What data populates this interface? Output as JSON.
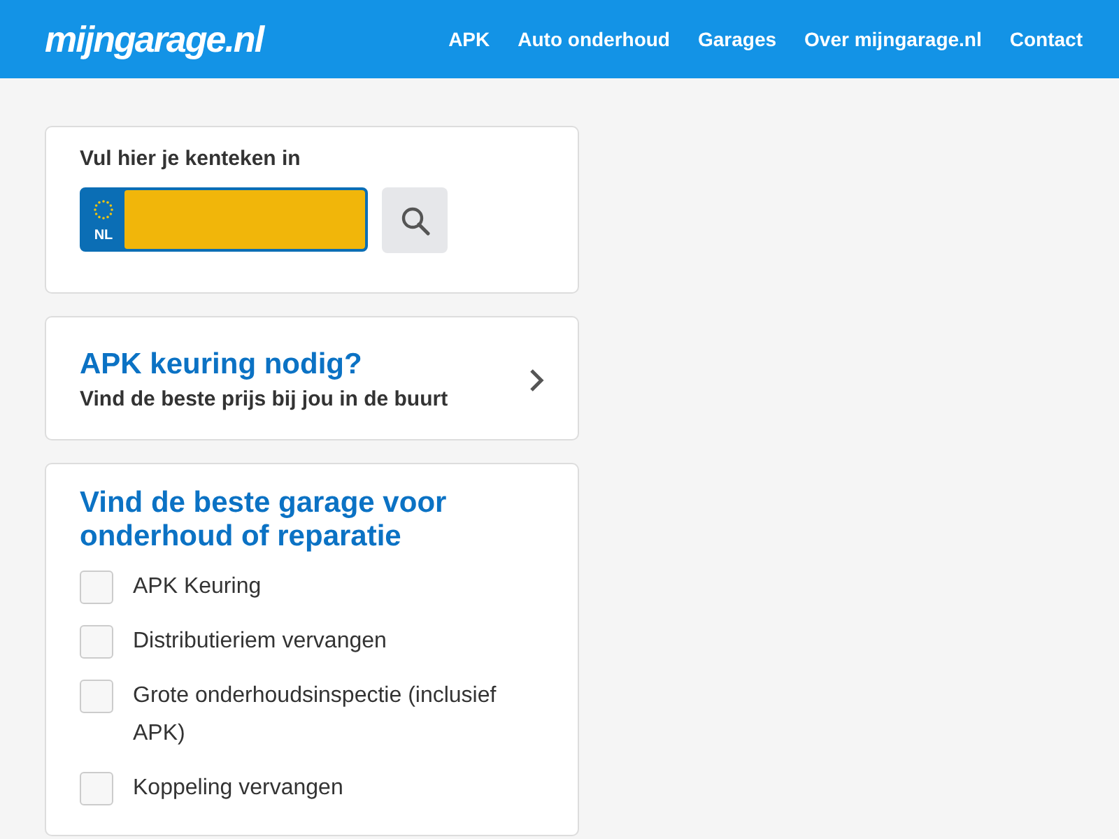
{
  "header": {
    "logo": "mijngarage.nl",
    "nav": [
      "APK",
      "Auto onderhoud",
      "Garages",
      "Over mijngarage.nl",
      "Contact"
    ]
  },
  "plate_card": {
    "label": "Vul hier je kenteken in",
    "country": "NL"
  },
  "apk_card": {
    "title": "APK keuring nodig?",
    "subtitle": "Vind de beste prijs bij jou in de buurt"
  },
  "services_card": {
    "title": "Vind de beste garage voor onderhoud of reparatie",
    "options": [
      {
        "label": "APK Keuring",
        "checked": false
      },
      {
        "label": "Distributieriem vervangen",
        "checked": false
      },
      {
        "label": "Grote onderhoudsinspectie (inclusief APK)",
        "checked": false
      },
      {
        "label": "Koppeling vervangen",
        "checked": false
      }
    ]
  }
}
